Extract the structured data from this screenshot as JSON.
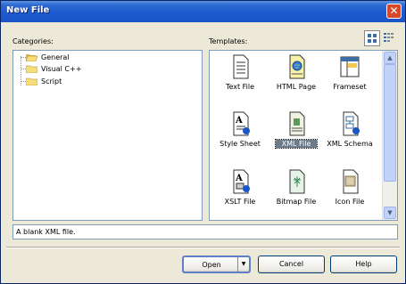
{
  "window": {
    "title": "New File",
    "close_icon": "close-icon"
  },
  "categories": {
    "label": "Categories:",
    "items": [
      {
        "label": "General",
        "icon": "folder-open-icon"
      },
      {
        "label": "Visual C++",
        "icon": "folder-icon"
      },
      {
        "label": "Script",
        "icon": "folder-icon"
      }
    ]
  },
  "templates": {
    "label": "Templates:",
    "view_buttons": [
      {
        "icon": "large-icons-view-icon",
        "active": true
      },
      {
        "icon": "list-view-icon",
        "active": false
      }
    ],
    "items": [
      {
        "label": "Text File",
        "icon": "text-file-icon"
      },
      {
        "label": "HTML Page",
        "icon": "html-page-icon"
      },
      {
        "label": "Frameset",
        "icon": "frameset-icon"
      },
      {
        "label": "Style Sheet",
        "icon": "style-sheet-icon"
      },
      {
        "label": "XML File",
        "icon": "xml-file-icon",
        "selected": true
      },
      {
        "label": "XML Schema",
        "icon": "xml-schema-icon"
      },
      {
        "label": "XSLT File",
        "icon": "xslt-file-icon"
      },
      {
        "label": "Bitmap File",
        "icon": "bitmap-file-icon"
      },
      {
        "label": "Icon File",
        "icon": "icon-file-icon"
      }
    ]
  },
  "description": "A blank XML file.",
  "buttons": {
    "open": "Open",
    "cancel": "Cancel",
    "help": "Help"
  },
  "colors": {
    "title_bar": "#1b5ad0",
    "selection": "#6b7c8c",
    "dialog_bg": "#ece9d8"
  }
}
